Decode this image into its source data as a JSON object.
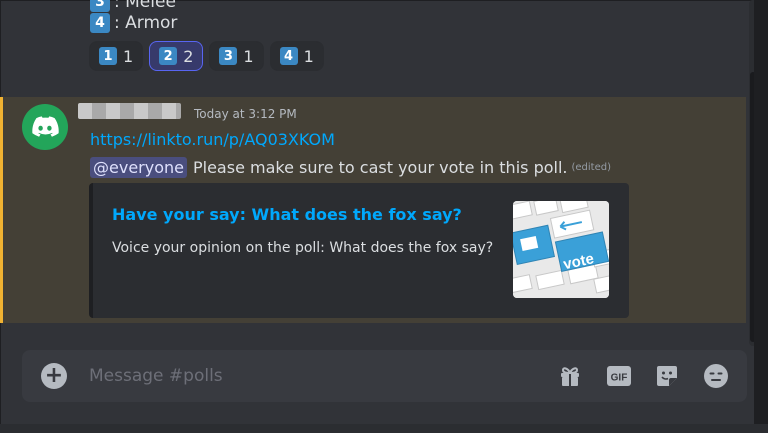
{
  "previous_message": {
    "option3": {
      "key": "3",
      "label": "Melee"
    },
    "option4": {
      "key": "4",
      "label": "Armor"
    },
    "reactions": [
      {
        "emoji": "1",
        "count": "1",
        "active": false
      },
      {
        "emoji": "2",
        "count": "2",
        "active": true
      },
      {
        "emoji": "3",
        "count": "1",
        "active": false
      },
      {
        "emoji": "4",
        "count": "1",
        "active": false
      }
    ]
  },
  "message": {
    "timestamp": "Today at 3:12 PM",
    "link": "https://linkto.run/p/AQ03XKOM",
    "mention": "@everyone",
    "text": "Please make sure to cast your vote in this poll.",
    "edited": "(edited)",
    "embed": {
      "title": "Have your say: What does the fox say?",
      "description": "Voice your opinion on the poll: What does the fox say?",
      "thumbnail_text": "vote"
    },
    "highlight_color": "#f0b232"
  },
  "composer": {
    "placeholder": "Message #polls",
    "icons": [
      "add-icon",
      "gift-icon",
      "gif-icon",
      "sticker-icon",
      "emoji-icon"
    ],
    "gif_label": "GIF"
  },
  "colors": {
    "link": "#00a8fc",
    "avatar": "#23a55a",
    "background": "#313338"
  }
}
